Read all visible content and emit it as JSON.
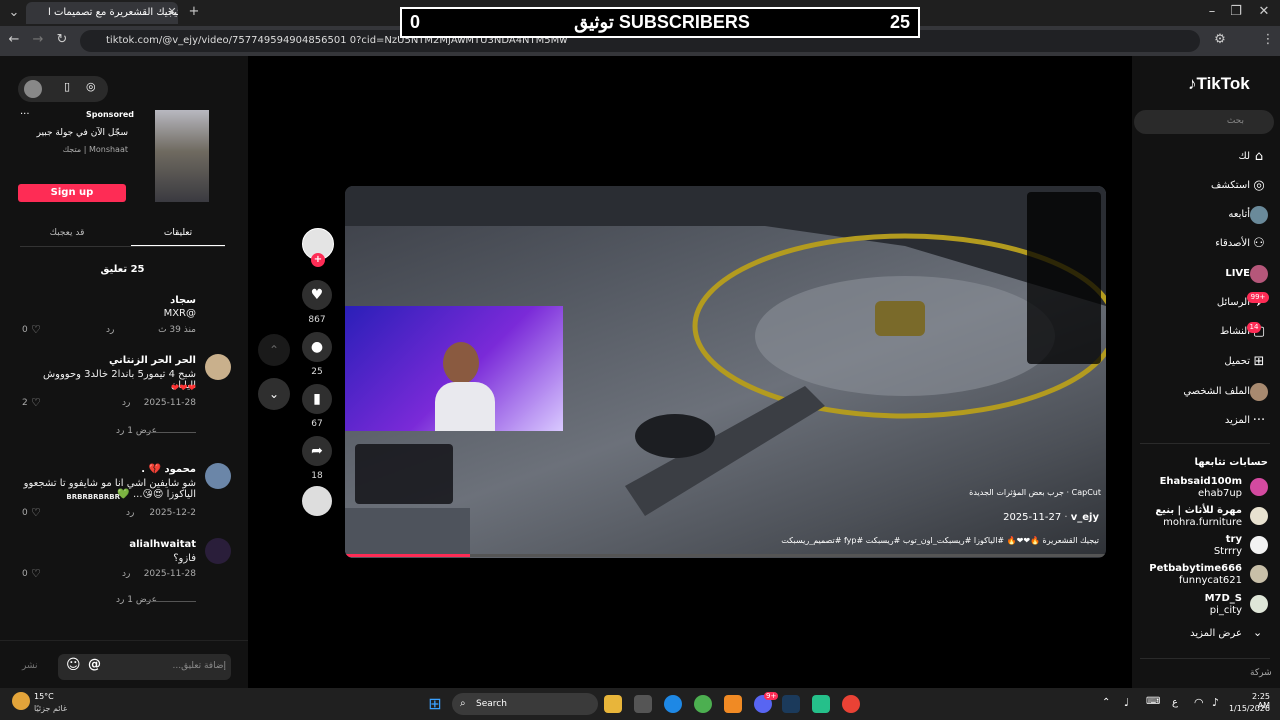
{
  "browser": {
    "tab_title": "تيجيك القشعريرة مع تصميمات ا",
    "url": "tiktok.com/@v_ejy/video/757749594904856501 0?cid=NzU5NTM2MjAwMTU3NDA4NTM5Mw"
  },
  "overlay": {
    "left_number": "25",
    "label": "توثيق SUBSCRIBERS",
    "right_number": "0"
  },
  "ad": {
    "badge": "Sponsored",
    "title": "سجّل الآن في جولة جبير",
    "sponsor": "متجك | Monshaat",
    "signup": "Sign up"
  },
  "comment_tabs": [
    "تعليقات",
    "قد يعجبك"
  ],
  "comment_count": "25 تعليق",
  "comments": [
    {
      "name": "سجاد",
      "text": "@MXR",
      "date": "منذ 39 ث",
      "reply": "رد",
      "likes": "0"
    },
    {
      "name": "الحر الحر الزنتاني",
      "text": "شبح 4 تيمور5 باندا2 خالد3 وحوووش اليابان",
      "emoji": "❤❤❤",
      "date": "2025-11-28",
      "reply": "رد",
      "likes": "2",
      "view_replies": "عرض 1 رد"
    },
    {
      "name": "محمود 💔 .",
      "text": "شو شايفين اشي انا مو شايفوو تا تشجعوو الياكوزا 😍😘... 💚",
      "extra": "BRBRBRBRBR",
      "date": "2025-12-2",
      "reply": "رد",
      "likes": "0"
    },
    {
      "name": "alialhwaitat",
      "text": "فازو؟",
      "date": "2025-11-28",
      "reply": "رد",
      "likes": "0",
      "view_replies": "عرض 1 رد"
    }
  ],
  "comment_input": {
    "placeholder": "إضافة تعليق...",
    "post": "نشر"
  },
  "video": {
    "capcut": "CapCut · جرب بعض المؤثرات الجديدة",
    "author": "v_ejy",
    "date": "2025-11-27",
    "caption": "تيجيك القشعريرة 🔥❤❤🔥 #الياكوزا #ريسبكت_اون_توب #ريسبكت #fyp #تصميم_ريسبكت"
  },
  "actions": {
    "likes": "867",
    "comments": "25",
    "saves": "67",
    "shares": "18"
  },
  "tiktok": {
    "logo": "TikTok",
    "search_placeholder": "بحث",
    "nav": [
      "لك",
      "استكشف",
      "أتابعه",
      "الأصدقاء",
      "LIVE",
      "الرسائل",
      "النشاط",
      "تحميل",
      "الملف الشخصي",
      "المزيد"
    ],
    "messages_badge": "99+",
    "activity_badge": "14",
    "following_title": "حسابات تتابعها",
    "accounts": [
      {
        "name": "Ehabsaid100m",
        "sub": "ehab7up"
      },
      {
        "name": "مهرة للأثاث | بنيع",
        "sub": "mohra.furniture"
      },
      {
        "name": "try",
        "sub": "Strrry"
      },
      {
        "name": "Petbabytime666",
        "sub": "funnycat621"
      },
      {
        "name": "M7D_S",
        "sub": "pi_city"
      }
    ],
    "see_more": "عرض المزيد",
    "company": "شركة"
  },
  "taskbar": {
    "weather_temp": "15°C",
    "weather_desc": "غائم جزئيًا",
    "search": "Search",
    "lang": "ع",
    "time": "2:25 AM",
    "date": "1/15/2026",
    "discord_badge": "9+"
  }
}
